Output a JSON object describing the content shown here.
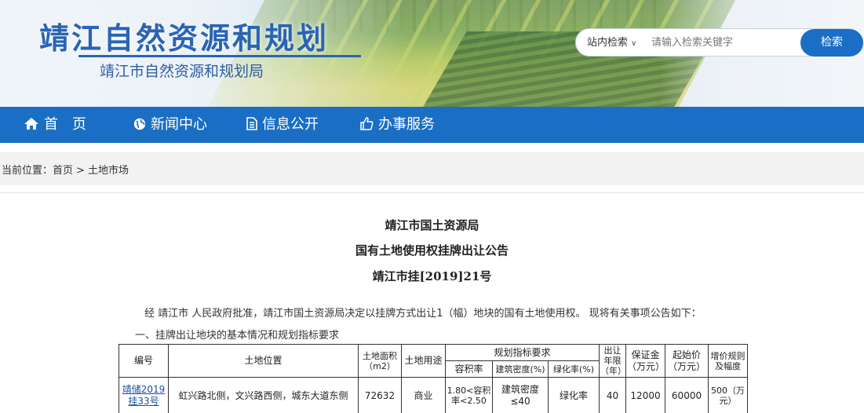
{
  "header": {
    "site_title": "靖江自然资源和规划",
    "site_subtitle": "靖江市自然资源和规划局",
    "search": {
      "scope_label": "站内检索",
      "placeholder": "请输入检索关键字",
      "button_label": "检索"
    }
  },
  "nav": {
    "items": [
      {
        "label": "首　页",
        "icon": "home-icon"
      },
      {
        "label": "新闻中心",
        "icon": "globe-icon"
      },
      {
        "label": "信息公开",
        "icon": "document-icon"
      },
      {
        "label": "办事服务",
        "icon": "thumbs-up-icon"
      }
    ]
  },
  "breadcrumb": {
    "prefix": "当前位置：",
    "home": "首页",
    "separator": ">",
    "current": "土地市场"
  },
  "article": {
    "issuer": "靖江市国土资源局",
    "title": "国有土地使用权挂牌出让公告",
    "doc_number": "靖江市挂[2019]21号",
    "intro": "经 靖江市 人民政府批准，靖江市国土资源局决定以挂牌方式出让1（幅）地块的国有土地使用权。 现将有关事项公告如下：",
    "section1": "一、挂牌出让地块的基本情况和规划指标要求"
  },
  "land_table": {
    "headers": {
      "no": "编号",
      "location": "土地位置",
      "area": "土地面积（m2）",
      "use": "土地用途",
      "planning": "规划指标要求",
      "far": "容积率",
      "density": "建筑密度(%)",
      "green": "绿化率(%)",
      "term": "出让年限（年）",
      "deposit": "保证金（万元）",
      "start_price": "起始价（万元）",
      "increment": "增价规则及幅度"
    },
    "rows": [
      {
        "no": "靖储2019挂33号",
        "location": "虹兴路北侧，文兴路西侧，城东大道东侧",
        "area": "72632",
        "use": "商业",
        "far": "1.80<容积率<2.50",
        "density": "建筑密度≤40",
        "green": "绿化率",
        "term": "40",
        "deposit": "12000",
        "start_price": "60000",
        "increment": "500（万元）"
      }
    ]
  }
}
